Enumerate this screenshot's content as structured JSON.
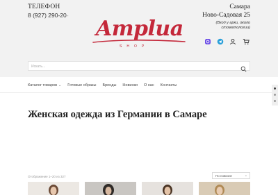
{
  "header": {
    "phone_title": "ТЕЛЕФОН",
    "phone_main": "8 (927)",
    "phone_tail_visible": " 290-20",
    "phone_tail_faded": "-",
    "city": "Самара",
    "street": "Ново-Садовая 25",
    "entrance": "(Вход у арки, около стоматологии)"
  },
  "logo": {
    "word": "Amplua",
    "shop": "SHOP",
    "color": "#c4283a"
  },
  "icons": [
    "instagram-icon",
    "telegram-icon",
    "user-icon",
    "cart-icon"
  ],
  "search": {
    "placeholder": "Искать..."
  },
  "nav": {
    "items": [
      {
        "label": "Каталог товаров",
        "has_dropdown": true
      },
      {
        "label": "Готовые образы"
      },
      {
        "label": "Бренды"
      },
      {
        "label": "Новинки"
      },
      {
        "label": "О нас"
      },
      {
        "label": "Контакты"
      }
    ]
  },
  "main": {
    "heading": "Женская одежда из Германии в Самаре",
    "showing": "Отображение 1–20 из 327",
    "sort_label": "По новизне"
  }
}
